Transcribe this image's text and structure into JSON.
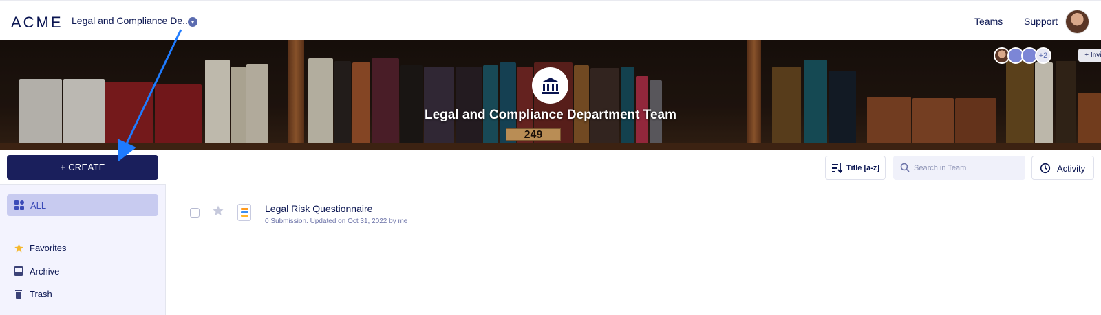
{
  "header": {
    "logo": "ACME",
    "team_selector": "Legal and Compliance De...",
    "nav": [
      "Teams",
      "Support"
    ]
  },
  "banner": {
    "title": "Legal and Compliance Department Team",
    "shelf_sign": "249",
    "member_overflow": "+2",
    "invite_label": "+ Invite"
  },
  "sidebar": {
    "create_label": "+ CREATE",
    "all_label": "ALL",
    "items": [
      {
        "label": "Favorites",
        "icon": "star-icon"
      },
      {
        "label": "Archive",
        "icon": "archive-icon"
      },
      {
        "label": "Trash",
        "icon": "trash-icon"
      }
    ]
  },
  "toolbar": {
    "sort_label": "Title [a-z]",
    "search_placeholder": "Search in Team",
    "activity_label": "Activity"
  },
  "forms": [
    {
      "title": "Legal Risk Questionnaire",
      "meta": "0 Submission. Updated on Oct 31, 2022 by me"
    }
  ],
  "colors": {
    "primary": "#1a1f5c",
    "accent_blue": "#3b4bb8",
    "annotation_arrow": "#1e7bff",
    "sidebar_bg": "#f3f3fe"
  }
}
